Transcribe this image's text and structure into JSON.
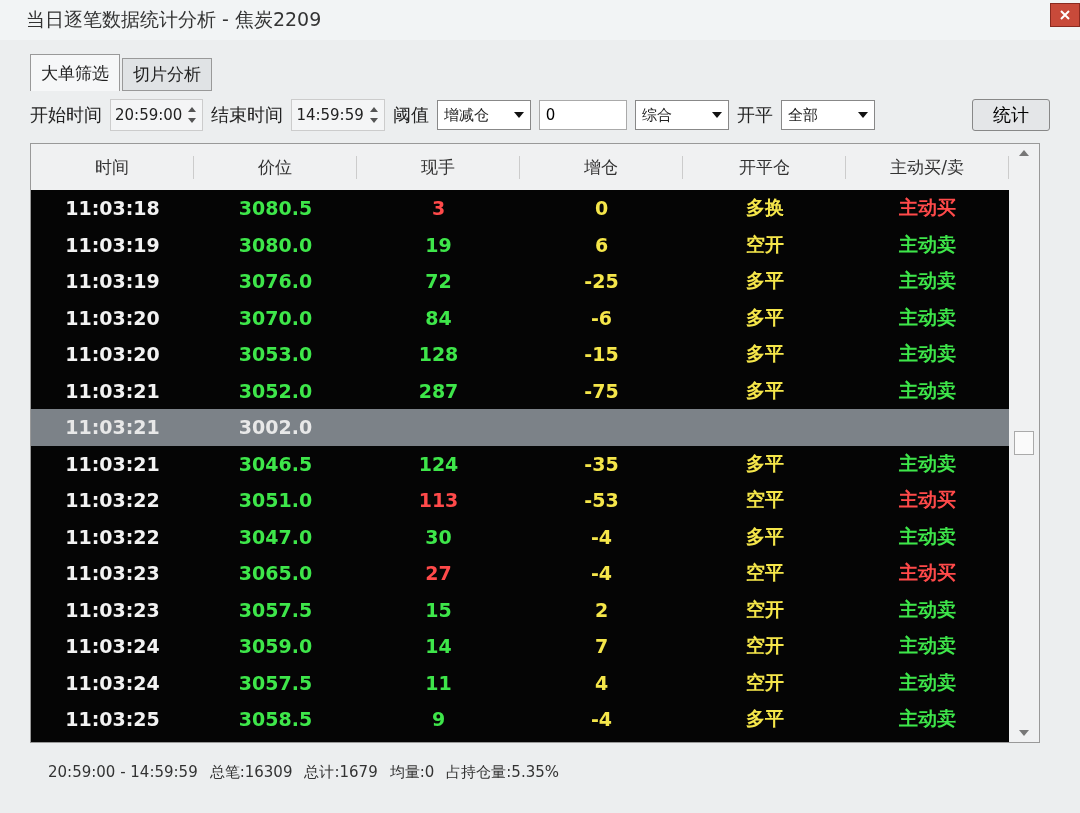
{
  "window": {
    "title": "当日逐笔数据统计分析 - 焦炭2209"
  },
  "tabs": [
    {
      "label": "大单筛选",
      "selected": true
    },
    {
      "label": "切片分析",
      "selected": false
    }
  ],
  "filters": {
    "start_label": "开始时间",
    "start_value": "20:59:00",
    "end_label": "结束时间",
    "end_value": "14:59:59",
    "threshold_label": "阈值",
    "threshold_select": "增减仓",
    "threshold_value": "0",
    "mode_select": "综合",
    "openclose_label": "开平",
    "openclose_select": "全部",
    "submit": "统计"
  },
  "table": {
    "columns": [
      "时间",
      "价位",
      "现手",
      "增仓",
      "开平仓",
      "主动买/卖"
    ],
    "rows": [
      {
        "time": "11:03:18",
        "price": "3080.5",
        "volume": "3",
        "change": "0",
        "type": "多换",
        "color": "#ff4a4a",
        "direction": "主动买",
        "selected": false
      },
      {
        "time": "11:03:19",
        "price": "3080.0",
        "volume": "19",
        "change": "6",
        "type": "空开",
        "color": "#3ee64a",
        "direction": "主动卖",
        "selected": false
      },
      {
        "time": "11:03:19",
        "price": "3076.0",
        "volume": "72",
        "change": "-25",
        "type": "多平",
        "color": "#3ee64a",
        "direction": "主动卖",
        "selected": false
      },
      {
        "time": "11:03:20",
        "price": "3070.0",
        "volume": "84",
        "change": "-6",
        "type": "多平",
        "color": "#3ee64a",
        "direction": "主动卖",
        "selected": false
      },
      {
        "time": "11:03:20",
        "price": "3053.0",
        "volume": "128",
        "change": "-15",
        "type": "多平",
        "color": "#3ee64a",
        "direction": "主动卖",
        "selected": false
      },
      {
        "time": "11:03:21",
        "price": "3052.0",
        "volume": "287",
        "change": "-75",
        "type": "多平",
        "color": "#3ee64a",
        "direction": "主动卖",
        "selected": false
      },
      {
        "time": "11:03:21",
        "price": "3002.0",
        "selected": true
      },
      {
        "time": "11:03:21",
        "price": "3046.5",
        "volume": "124",
        "change": "-35",
        "type": "多平",
        "color": "#3ee64a",
        "direction": "主动卖",
        "selected": false
      },
      {
        "time": "11:03:22",
        "price": "3051.0",
        "volume": "113",
        "change": "-53",
        "type": "空平",
        "color": "#ff4a4a",
        "direction": "主动买",
        "selected": false
      },
      {
        "time": "11:03:22",
        "price": "3047.0",
        "volume": "30",
        "change": "-4",
        "type": "多平",
        "color": "#3ee64a",
        "direction": "主动卖",
        "selected": false
      },
      {
        "time": "11:03:23",
        "price": "3065.0",
        "volume": "27",
        "change": "-4",
        "type": "空平",
        "color": "#ff4a4a",
        "direction": "主动买",
        "selected": false
      },
      {
        "time": "11:03:23",
        "price": "3057.5",
        "volume": "15",
        "change": "2",
        "type": "空开",
        "color": "#3ee64a",
        "direction": "主动卖",
        "selected": false
      },
      {
        "time": "11:03:24",
        "price": "3059.0",
        "volume": "14",
        "change": "7",
        "type": "空开",
        "color": "#3ee64a",
        "direction": "主动卖",
        "selected": false
      },
      {
        "time": "11:03:24",
        "price": "3057.5",
        "volume": "11",
        "change": "4",
        "type": "空开",
        "color": "#3ee64a",
        "direction": "主动卖",
        "selected": false
      },
      {
        "time": "11:03:25",
        "price": "3058.5",
        "volume": "9",
        "change": "-4",
        "type": "多平",
        "color": "#3ee64a",
        "direction": "主动卖",
        "selected": false
      }
    ]
  },
  "status_bar": [
    "20:59:00 - 14:59:59",
    "总笔:16309",
    "总计:1679",
    "均量:0",
    "占持仓量:5.35%"
  ]
}
